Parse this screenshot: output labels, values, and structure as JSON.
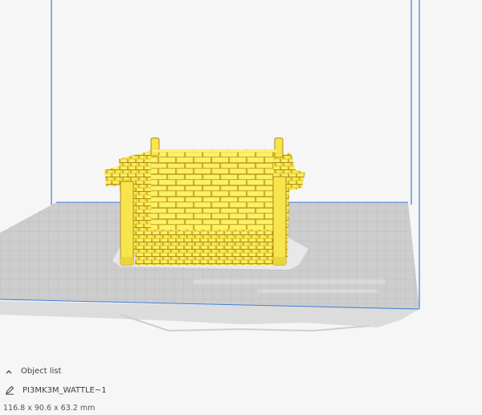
{
  "object_panel": {
    "header_label": "Object list",
    "header_icon": "chevron-up-icon",
    "item_name": "PI3MK3M_WATTLE~1",
    "item_icon": "pencil-icon",
    "dimensions": "116.8 x 90.6 x 63.2 mm"
  },
  "viewport": {
    "background_color": "#f6f6f6",
    "build_volume_color": "#3b7ddd",
    "build_plate_color": "#c8c8c8",
    "model_color": "#f4e64a",
    "model_shadow_color": "#c7a520"
  }
}
